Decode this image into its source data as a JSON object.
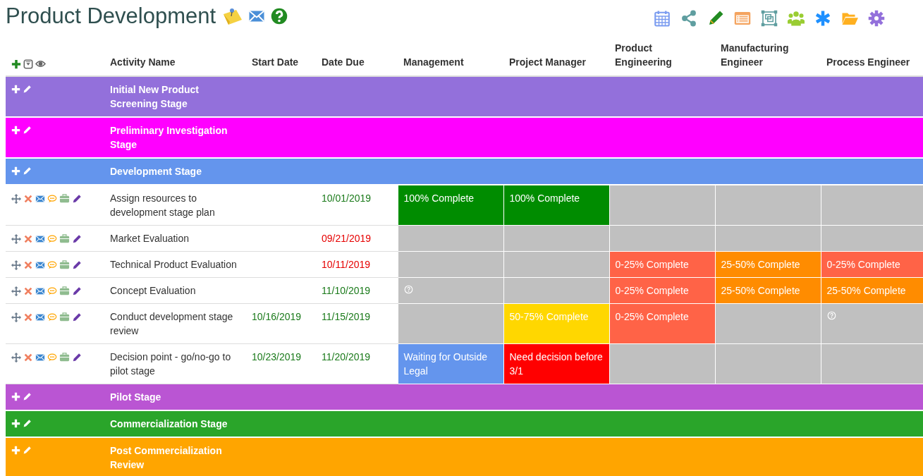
{
  "title": "Product Development",
  "columns": [
    "Activity Name",
    "Start Date",
    "Date Due",
    "Management",
    "Project Manager",
    "Product Engineering",
    "Manufacturing Engineer",
    "Process Engineer"
  ],
  "rows": [
    {
      "kind": "stage",
      "name": "Initial New Product Screening Stage",
      "color": "#9370db"
    },
    {
      "kind": "stage",
      "name": "Preliminary Investigation Stage",
      "color": "#ff00ff"
    },
    {
      "kind": "stage",
      "name": "Development Stage",
      "color": "#6495ed"
    },
    {
      "kind": "task",
      "name": "Assign resources to development stage plan",
      "due": "10/01/2019",
      "overdue": false,
      "cells": [
        {
          "kind": "status",
          "text": "100% Complete",
          "color": "#008c00"
        },
        {
          "kind": "status",
          "text": "100% Complete",
          "color": "#008c00"
        },
        {
          "kind": "empty"
        },
        {
          "kind": "empty"
        },
        {
          "kind": "empty"
        }
      ]
    },
    {
      "kind": "task",
      "name": "Market Evaluation",
      "due": "09/21/2019",
      "overdue": true,
      "cells": [
        {
          "kind": "empty"
        },
        {
          "kind": "empty"
        },
        {
          "kind": "empty"
        },
        {
          "kind": "empty"
        },
        {
          "kind": "empty"
        }
      ]
    },
    {
      "kind": "task",
      "name": "Technical Product Evaluation",
      "due": "10/11/2019",
      "overdue": true,
      "cells": [
        {
          "kind": "empty"
        },
        {
          "kind": "empty"
        },
        {
          "kind": "status",
          "text": "0-25% Complete",
          "color": "#ff6347"
        },
        {
          "kind": "status",
          "text": "25-50% Complete",
          "color": "#ff8c00"
        },
        {
          "kind": "status",
          "text": "0-25% Complete",
          "color": "#ff6347"
        }
      ]
    },
    {
      "kind": "task",
      "name": "Concept Evaluation",
      "due": "11/10/2019",
      "overdue": false,
      "cells": [
        {
          "kind": "unknown"
        },
        {
          "kind": "empty"
        },
        {
          "kind": "status",
          "text": "0-25% Complete",
          "color": "#ff6347"
        },
        {
          "kind": "status",
          "text": "25-50% Complete",
          "color": "#ff8c00"
        },
        {
          "kind": "status",
          "text": "25-50% Complete",
          "color": "#ff8c00"
        }
      ]
    },
    {
      "kind": "task",
      "name": "Conduct development stage review",
      "start": "10/16/2019",
      "due": "11/15/2019",
      "overdue": false,
      "cells": [
        {
          "kind": "empty"
        },
        {
          "kind": "status",
          "text": "50-75% Complete",
          "color": "#ffd700"
        },
        {
          "kind": "status",
          "text": "0-25% Complete",
          "color": "#ff6347"
        },
        {
          "kind": "empty"
        },
        {
          "kind": "unknown"
        }
      ]
    },
    {
      "kind": "task",
      "name": "Decision point - go/no-go to pilot stage",
      "start": "10/23/2019",
      "due": "11/20/2019",
      "overdue": false,
      "cells": [
        {
          "kind": "status",
          "text": "Waiting for Outside Legal",
          "color": "#6495ed"
        },
        {
          "kind": "status",
          "text": "Need decision before 3/1",
          "color": "#ff0000"
        },
        {
          "kind": "empty"
        },
        {
          "kind": "empty"
        },
        {
          "kind": "empty"
        }
      ]
    },
    {
      "kind": "stage",
      "name": "Pilot Stage",
      "color": "#ba55d3"
    },
    {
      "kind": "stage",
      "name": "Commercialization Stage",
      "color": "#2aa52a"
    },
    {
      "kind": "stage",
      "name": "Post Commercialization Review",
      "color": "#ffa500"
    }
  ]
}
